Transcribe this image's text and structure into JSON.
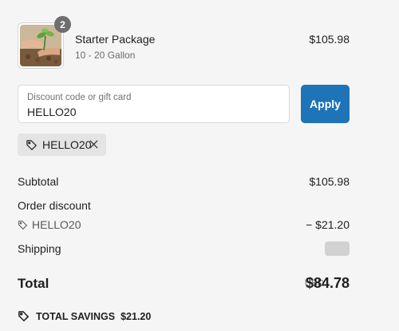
{
  "product": {
    "quantity": "2",
    "name": "Starter Package",
    "variant": "10 - 20 Gallon",
    "price": "$105.98",
    "image_icon": "plant-seedling-photo"
  },
  "discount": {
    "field_label": "Discount code or gift card",
    "field_value": "HELLO20",
    "apply_label": "Apply",
    "applied_code": "HELLO20",
    "tag_icon": "tag-icon",
    "remove_icon": "close-icon"
  },
  "summary": {
    "subtotal_label": "Subtotal",
    "subtotal_value": "$105.98",
    "order_discount_label": "Order discount",
    "discount_code": "HELLO20",
    "discount_value": "− $21.20",
    "shipping_label": "Shipping",
    "total_label": "Total",
    "currency": "USD",
    "total_value": "$84.78",
    "savings_label": "TOTAL SAVINGS",
    "savings_value": "$21.20"
  },
  "colors": {
    "accent": "#1f73b7",
    "background": "#f5f5f5",
    "badge": "#6e6e6e"
  }
}
